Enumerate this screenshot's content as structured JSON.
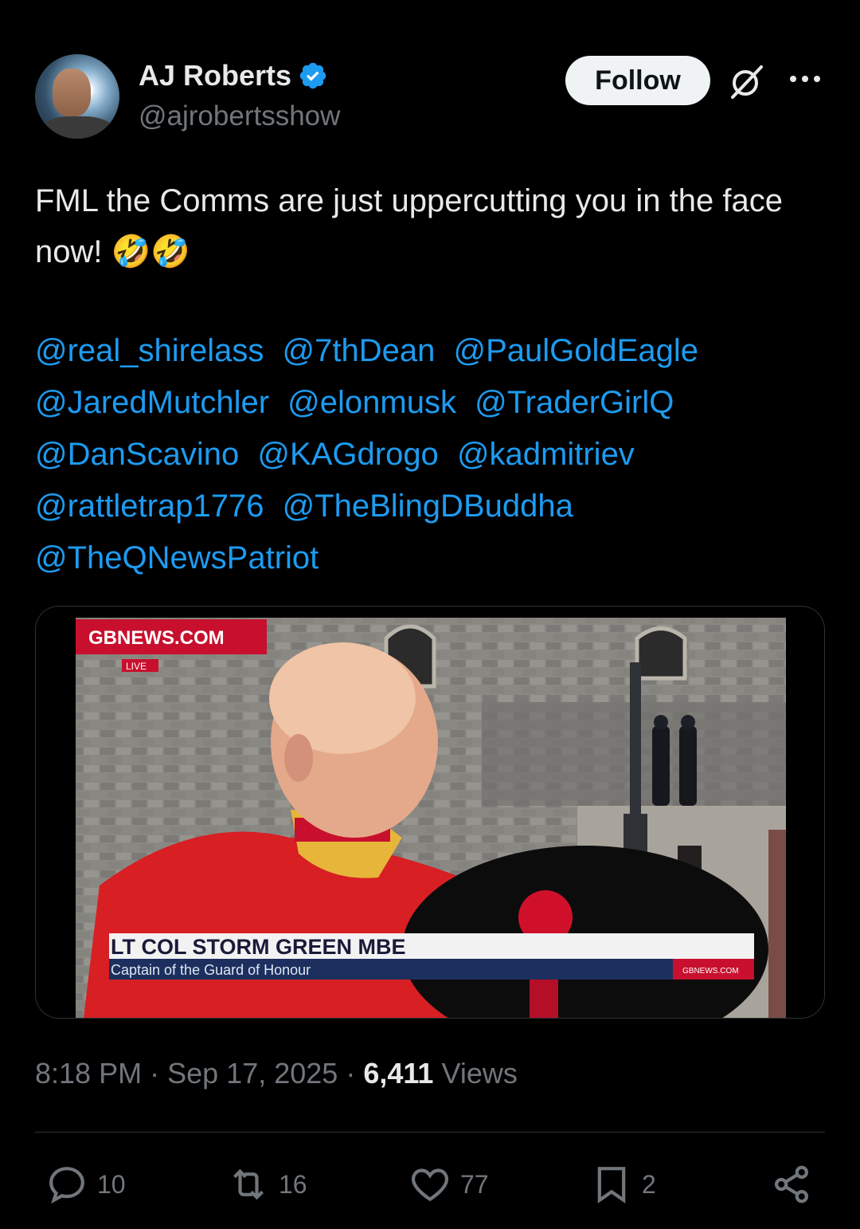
{
  "author": {
    "name": "AJ Roberts",
    "handle": "@ajrobertsshow",
    "verified_icon": "verified-badge-icon"
  },
  "header": {
    "follow_label": "Follow",
    "grok_icon": "grok-icon",
    "more_icon": "more-options-icon"
  },
  "tweet": {
    "text": "FML the Comms are just uppercutting you in the face now!",
    "emojis": "🤣🤣",
    "mentions": [
      "@real_shirelass",
      "@7thDean",
      "@PaulGoldEagle",
      "@JaredMutchler",
      "@elonmusk",
      "@TraderGirlQ",
      "@DanScavino",
      "@KAGdrogo",
      "@kadmitriev",
      "@rattletrap1776",
      "@TheBlingDBuddha",
      "@TheQNewsPatriot"
    ]
  },
  "media": {
    "brand": "GBNEWS.COM",
    "live_tag": "LIVE",
    "lower_third_title": "LT COL STORM GREEN MBE",
    "lower_third_subtitle": "Captain of the Guard of Honour",
    "corner_brand": "GBNEWS.COM"
  },
  "meta": {
    "time": "8:18 PM",
    "separator": "·",
    "date": "Sep 17, 2025",
    "views_count": "6,411",
    "views_label": "Views"
  },
  "actions": {
    "replies": "10",
    "reposts": "16",
    "likes": "77",
    "bookmarks": "2"
  },
  "colors": {
    "background": "#000000",
    "text": "#e7e9ea",
    "secondary": "#71767b",
    "link": "#1d9bf0",
    "verified": "#1d9bf0",
    "gbnews_red": "#c8102e"
  }
}
